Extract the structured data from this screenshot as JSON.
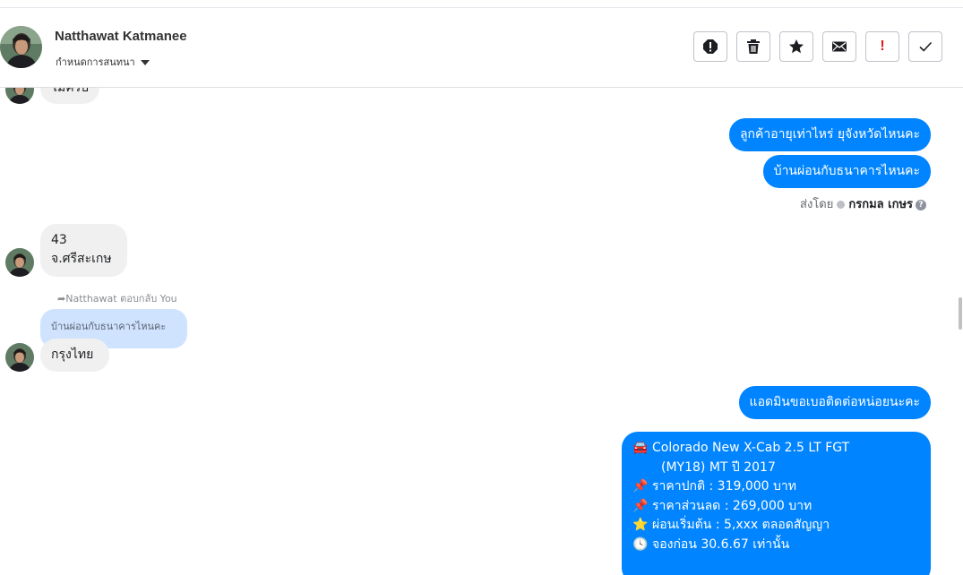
{
  "header": {
    "contact_name": "Natthawat Katmanee",
    "assign_label": "กำหนดการสนทนา",
    "actions": [
      {
        "name": "report-spam-icon"
      },
      {
        "name": "trash-icon"
      },
      {
        "name": "star-icon"
      },
      {
        "name": "mail-icon"
      },
      {
        "name": "important-icon",
        "glyph": "!"
      },
      {
        "name": "check-icon"
      }
    ]
  },
  "messages": {
    "in_cut": "ไม่ครับ",
    "out_1": "ลูกค้าอายุเท่าไหร่ ยุจังหวัดไหนคะ",
    "out_2": "บ้านผ่อนกับธนาคารไหนคะ",
    "sent_by_prefix": "ส่งโดย",
    "sent_by_name": "กรกมล เกษร",
    "in_age": "43",
    "in_province": "จ.ศรีสะเกษ",
    "reply_note": "Natthawat ตอบกลับ You",
    "reply_quote": "บ้านผ่อนกับธนาคารไหนคะ",
    "in_bank": "กรุงไทย",
    "out_3": "แอดมินขอเบอติดต่อหน่อยนะคะ",
    "card": {
      "line1": "Colorado New X-Cab 2.5 LT FGT",
      "line2": "(MY18) MT ปี 2017",
      "line3": "ราคาปกติ : 319,000 บาท",
      "line4": "ราคาส่วนลด : 269,000 บาท",
      "line5": "ผ่อนเริ่มต้น : 5,xxx ตลอดสัญญา",
      "line6": "จองก่อน 30.6.67 เท่านั้น"
    }
  },
  "colors": {
    "outgoing_bubble": "#0084ff",
    "incoming_bubble": "#f0f0f0",
    "reply_quote": "#cfe3ff",
    "important": "#e4171b"
  }
}
